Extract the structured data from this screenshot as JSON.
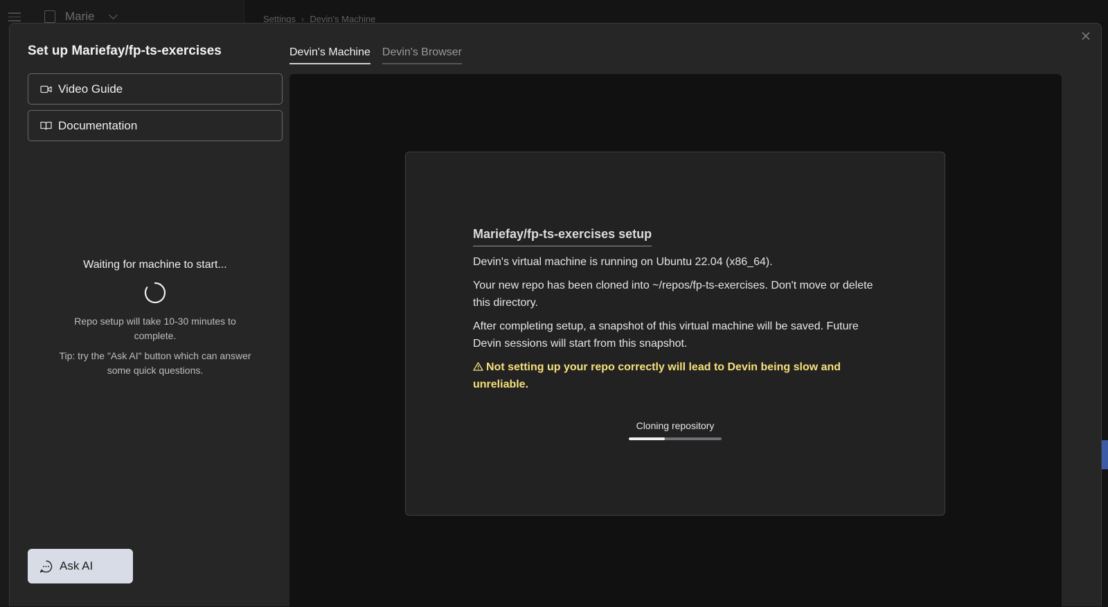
{
  "background": {
    "org_name": "Marie",
    "breadcrumb": [
      "Settings",
      "Devin's Machine"
    ]
  },
  "modal": {
    "title": "Set up Mariefay/fp-ts-exercises",
    "links": {
      "video_guide": "Video Guide",
      "documentation": "Documentation"
    },
    "waiting": {
      "title": "Waiting for machine to start...",
      "duration_text": "Repo setup will take 10-30 minutes to complete.",
      "tip_text": "Tip: try the \"Ask AI\" button which can answer some quick questions."
    },
    "ask_ai_label": "Ask AI",
    "tabs": [
      {
        "label": "Devin's Machine",
        "active": true
      },
      {
        "label": "Devin's Browser",
        "active": false
      }
    ],
    "card": {
      "title": "Mariefay/fp-ts-exercises setup",
      "paragraphs": [
        "Devin's virtual machine is running on Ubuntu 22.04 (x86_64).",
        "Your new repo has been cloned into ~/repos/fp-ts-exercises. Don't move or delete this directory.",
        "After completing setup, a snapshot of this virtual machine will be saved. Future Devin sessions will start from this snapshot."
      ],
      "warning_icon": "warning-triangle-icon",
      "warning_text": "Not setting up your repo correctly will lead to Devin being slow and unreliable.",
      "progress_label": "Cloning repository",
      "progress_fraction": 0.39
    }
  },
  "colors": {
    "warning": "#f7e07a",
    "ask_ai_bg": "#d8dce6",
    "edge_tab": "#3b5ba8"
  }
}
